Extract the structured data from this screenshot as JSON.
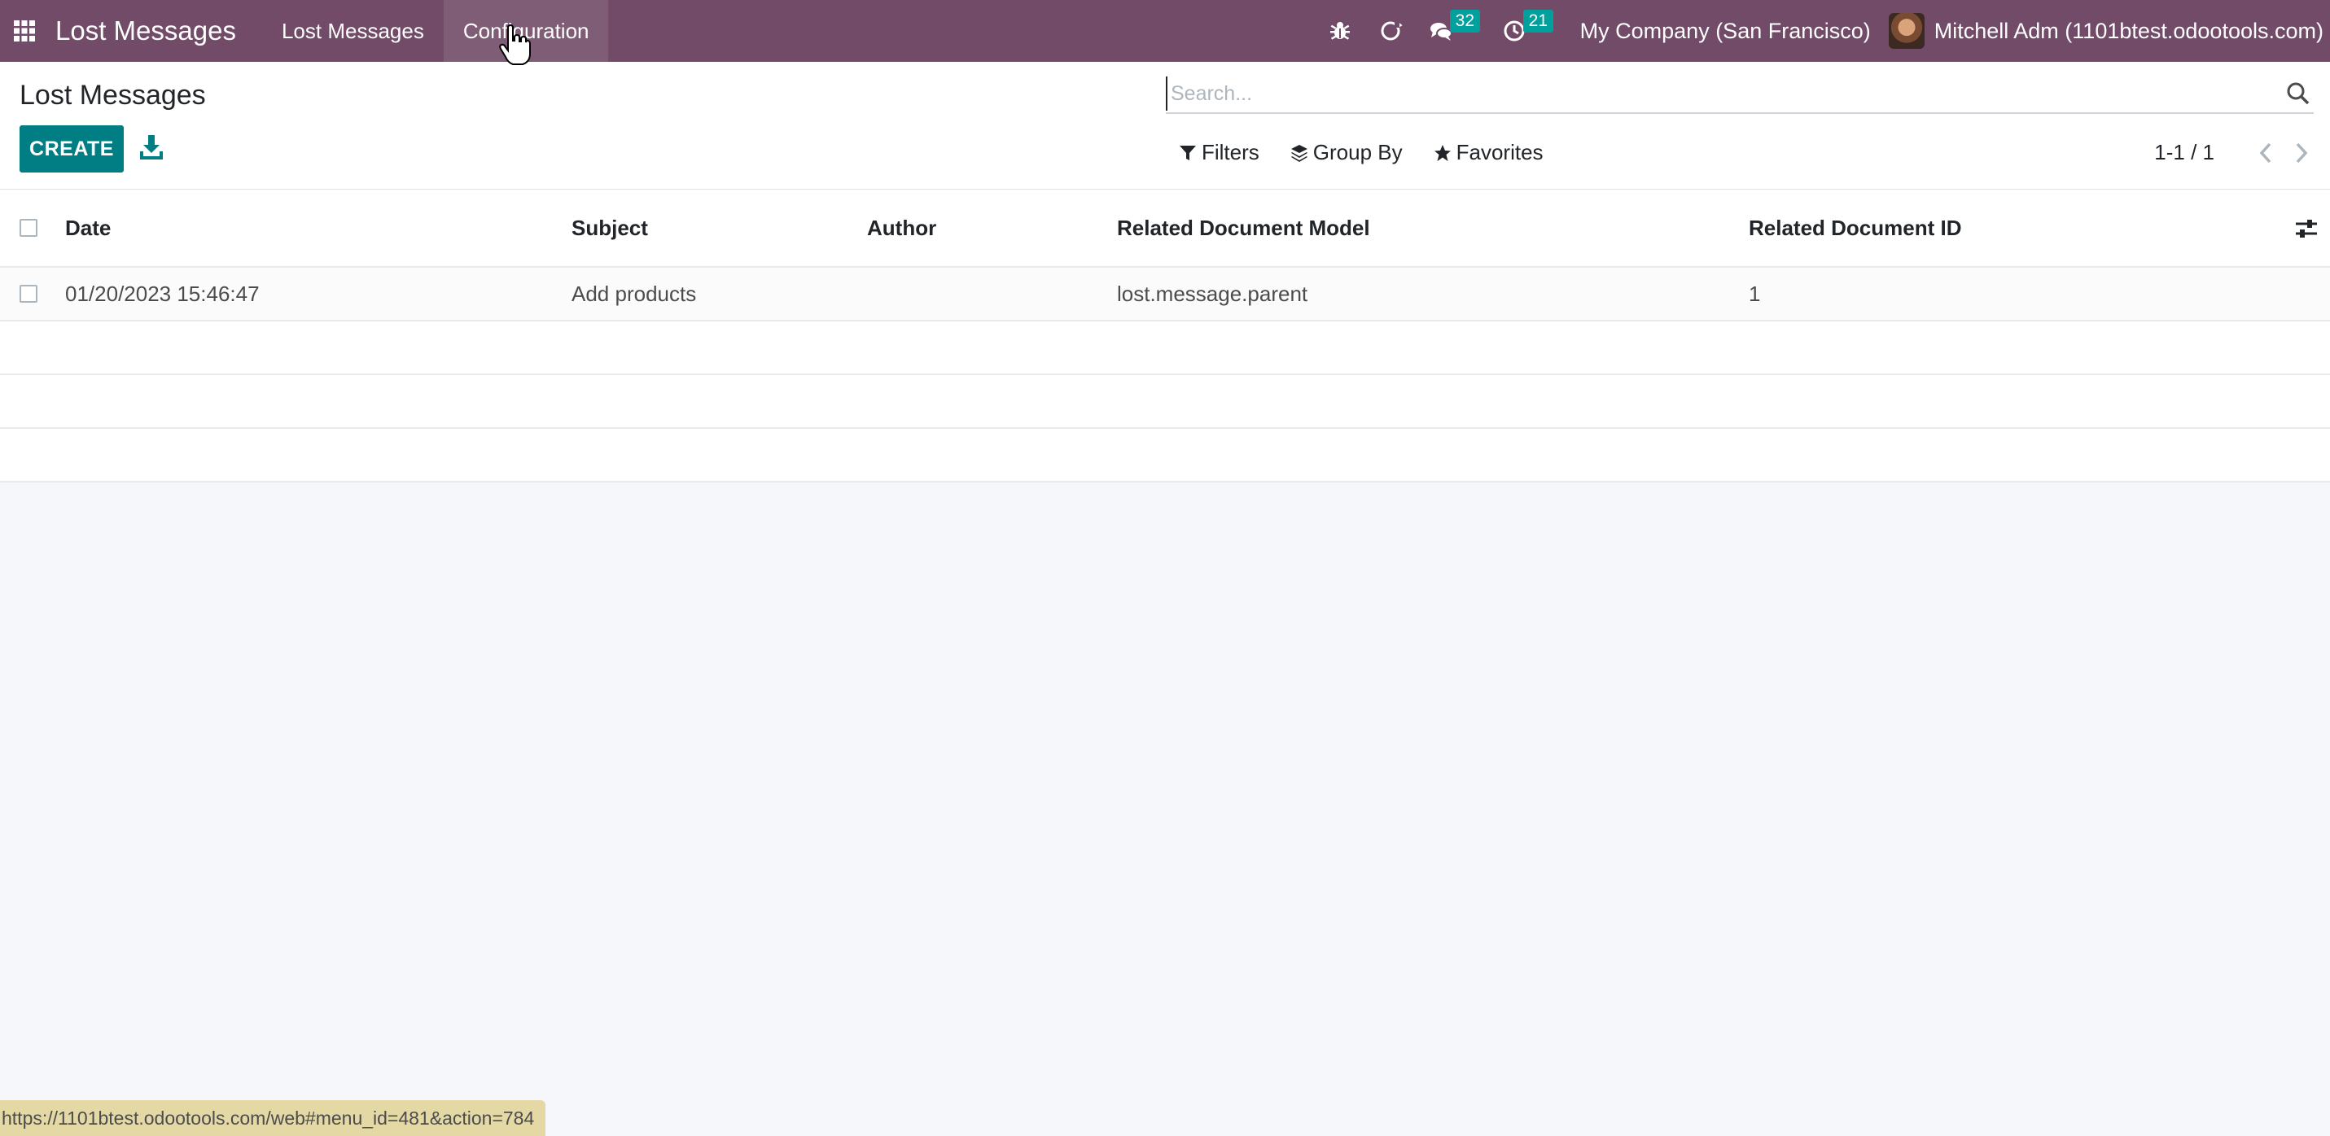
{
  "navbar": {
    "app_title": "Lost Messages",
    "menu": [
      "Lost Messages",
      "Configuration"
    ],
    "icons": [
      "apps-grid-icon",
      "bug-icon",
      "odoo-refresh-icon",
      "chat-icon",
      "clock-icon"
    ],
    "messages_badge": "32",
    "activities_badge": "21",
    "company": "My Company (San Francisco)",
    "user": "Mitchell Adm (1101btest.odootools.com)",
    "bg_color": "#714b67",
    "badge_color": "#00a09d"
  },
  "control_panel": {
    "title": "Lost Messages",
    "create_label": "CREATE",
    "search_placeholder": "Search...",
    "filters_label": "Filters",
    "group_by_label": "Group By",
    "favorites_label": "Favorites",
    "pager": "1-1 / 1",
    "accent_color": "#017e84"
  },
  "list": {
    "columns": [
      "Date",
      "Subject",
      "Author",
      "Related Document Model",
      "Related Document ID"
    ],
    "rows": [
      {
        "date": "01/20/2023 15:46:47",
        "subject": "Add products",
        "author": "",
        "model": "lost.message.parent",
        "res_id": "1"
      }
    ]
  },
  "status_url": "https://1101btest.odootools.com/web#menu_id=481&action=784"
}
